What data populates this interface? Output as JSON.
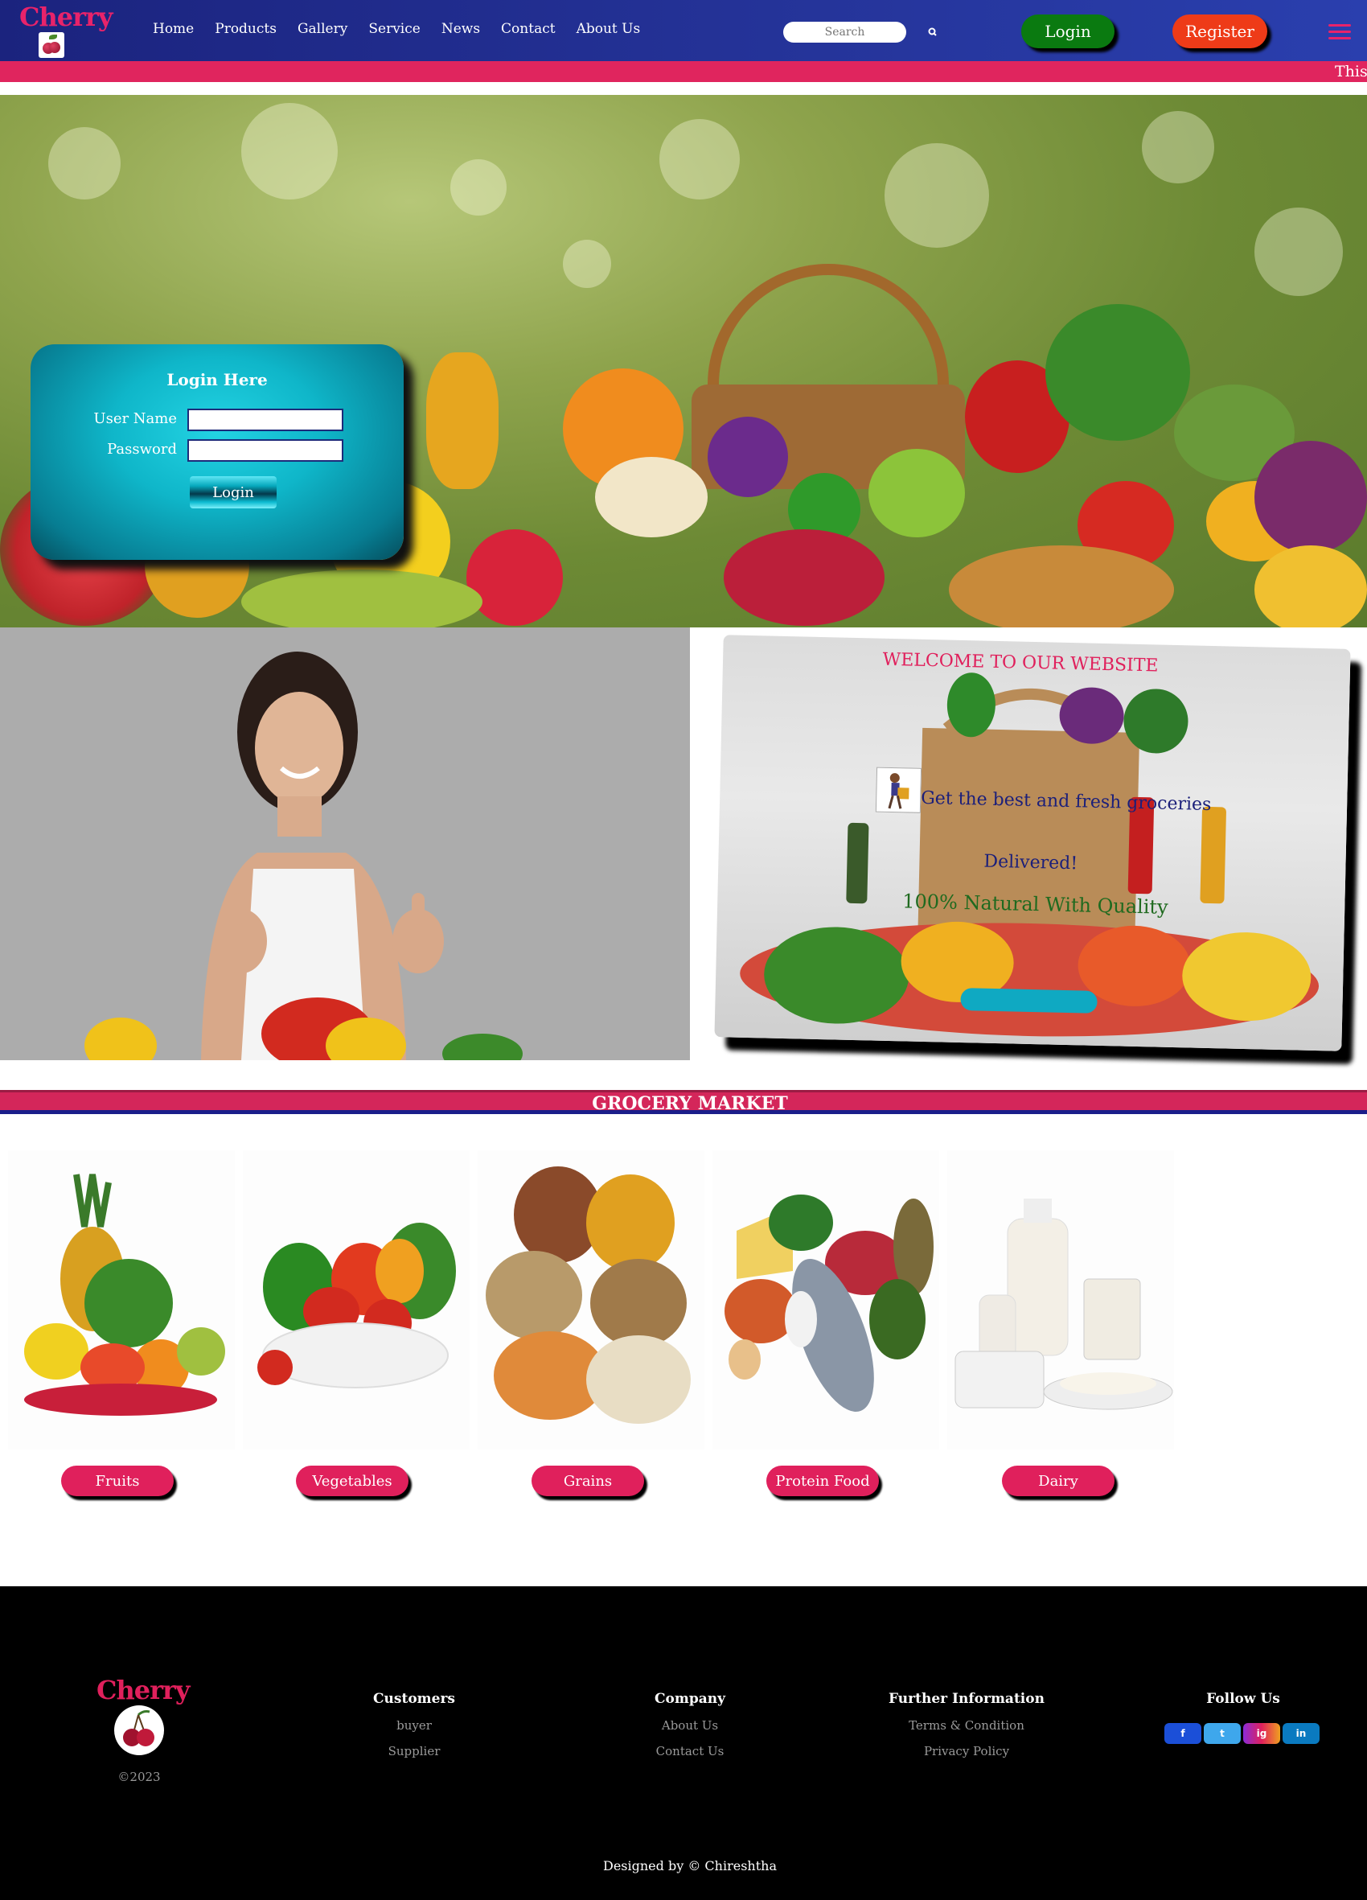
{
  "nav": {
    "brand": "Cherry",
    "menu": [
      "Home",
      "Products",
      "Gallery",
      "Service",
      "News",
      "Contact",
      "About Us"
    ],
    "search_placeholder": "Search",
    "login_label": "Login",
    "register_label": "Register"
  },
  "ticker": {
    "text": "This"
  },
  "login_form": {
    "title": "Login Here",
    "username_label": "User Name",
    "password_label": "Password",
    "submit_label": "Login"
  },
  "welcome": {
    "title": "WELCOME TO OUR WEBSITE",
    "line1": "Get the best and fresh groceries",
    "line2": "Delivered!",
    "line3": "100% Natural With Quality"
  },
  "grocery": {
    "title": "GROCERY MARKET",
    "categories": [
      "Fruits",
      "Vegetables",
      "Grains",
      "Protein Food",
      "Dairy"
    ]
  },
  "footer": {
    "brand": "Cherry",
    "copyright": "©2023",
    "customers": {
      "heading": "Customers",
      "links": [
        "buyer",
        "Supplier"
      ]
    },
    "company": {
      "heading": "Company",
      "links": [
        "About Us",
        "Contact Us"
      ]
    },
    "info": {
      "heading": "Further Information",
      "links": [
        "Terms & Condition",
        "Privacy Policy"
      ]
    },
    "follow": {
      "heading": "Follow Us",
      "icons": [
        "f",
        "t",
        "ig",
        "in"
      ]
    },
    "designed": "Designed by © Chireshtha"
  },
  "colors": {
    "accent": "#e0205c",
    "nav": "#1b237e",
    "login": "#0a7a10",
    "register": "#ee3b18"
  }
}
